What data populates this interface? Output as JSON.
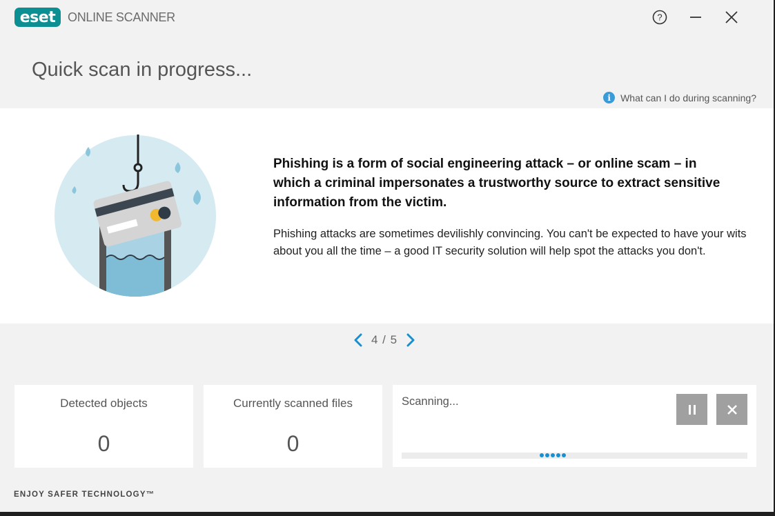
{
  "titlebar": {
    "logo_text": "eset",
    "app_name": "ONLINE SCANNER",
    "help_icon": "question-circle-icon",
    "minimize_icon": "minimize-icon",
    "close_icon": "close-icon"
  },
  "page": {
    "title": "Quick scan in progress...",
    "help_link": "What can I do during scanning?"
  },
  "tip": {
    "headline": "Phishing is a form of social engineering attack – or online scam – in which a criminal impersonates a trustworthy source to extract sensitive information from the victim.",
    "body": "Phishing attacks are sometimes devilishly convincing. You can't be expected to have your wits about you all the time – a good IT security solution will help spot the attacks you don't.",
    "illustration_icon": "phishing-hook-card-illustration"
  },
  "pager": {
    "current": 4,
    "total": 5,
    "label": "4 / 5"
  },
  "stats": {
    "detected_label": "Detected objects",
    "detected_value": "0",
    "scanned_label": "Currently scanned files",
    "scanned_value": "0"
  },
  "progress": {
    "status": "Scanning...",
    "pause_icon": "pause-icon",
    "stop_icon": "stop-x-icon"
  },
  "footer": {
    "tagline": "ENJOY SAFER TECHNOLOGY™"
  },
  "colors": {
    "brand_teal": "#0b8f92",
    "accent_blue": "#1a8fd0",
    "button_gray": "#a0a0a0"
  }
}
